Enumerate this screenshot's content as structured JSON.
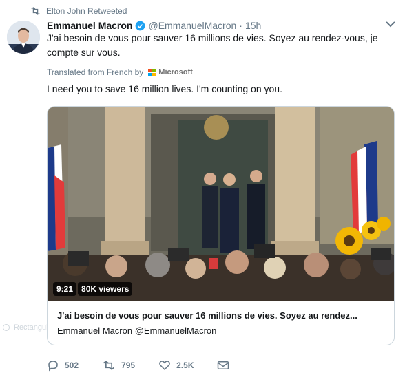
{
  "retweet": {
    "text": "Elton John Retweeted",
    "icon": "retweet-icon"
  },
  "tweet": {
    "name": "Emmanuel Macron",
    "handle": "@EmmanuelMacron",
    "separator": "·",
    "time": "15h",
    "text": "J'ai besoin de vous pour sauver 16 millions de vies. Soyez au rendez-vous, je compte sur vous.",
    "translated_from": "Translated from French by",
    "translator": "Microsoft",
    "translation": "I need you to save 16 million lives. I'm counting on you."
  },
  "card": {
    "duration": "9:21",
    "viewers": "80K viewers",
    "title": "J'ai besoin de vous pour sauver 16 millions de vies. Soyez au rendez...",
    "author": "Emmanuel Macron @EmmanuelMacron"
  },
  "background_label": "Rectangul",
  "actions": {
    "replies": "502",
    "retweets": "795",
    "likes": "2.5K"
  },
  "colors": {
    "verified": "#1da1f2",
    "secondary_text": "#657786",
    "border": "#ccd6dd"
  }
}
